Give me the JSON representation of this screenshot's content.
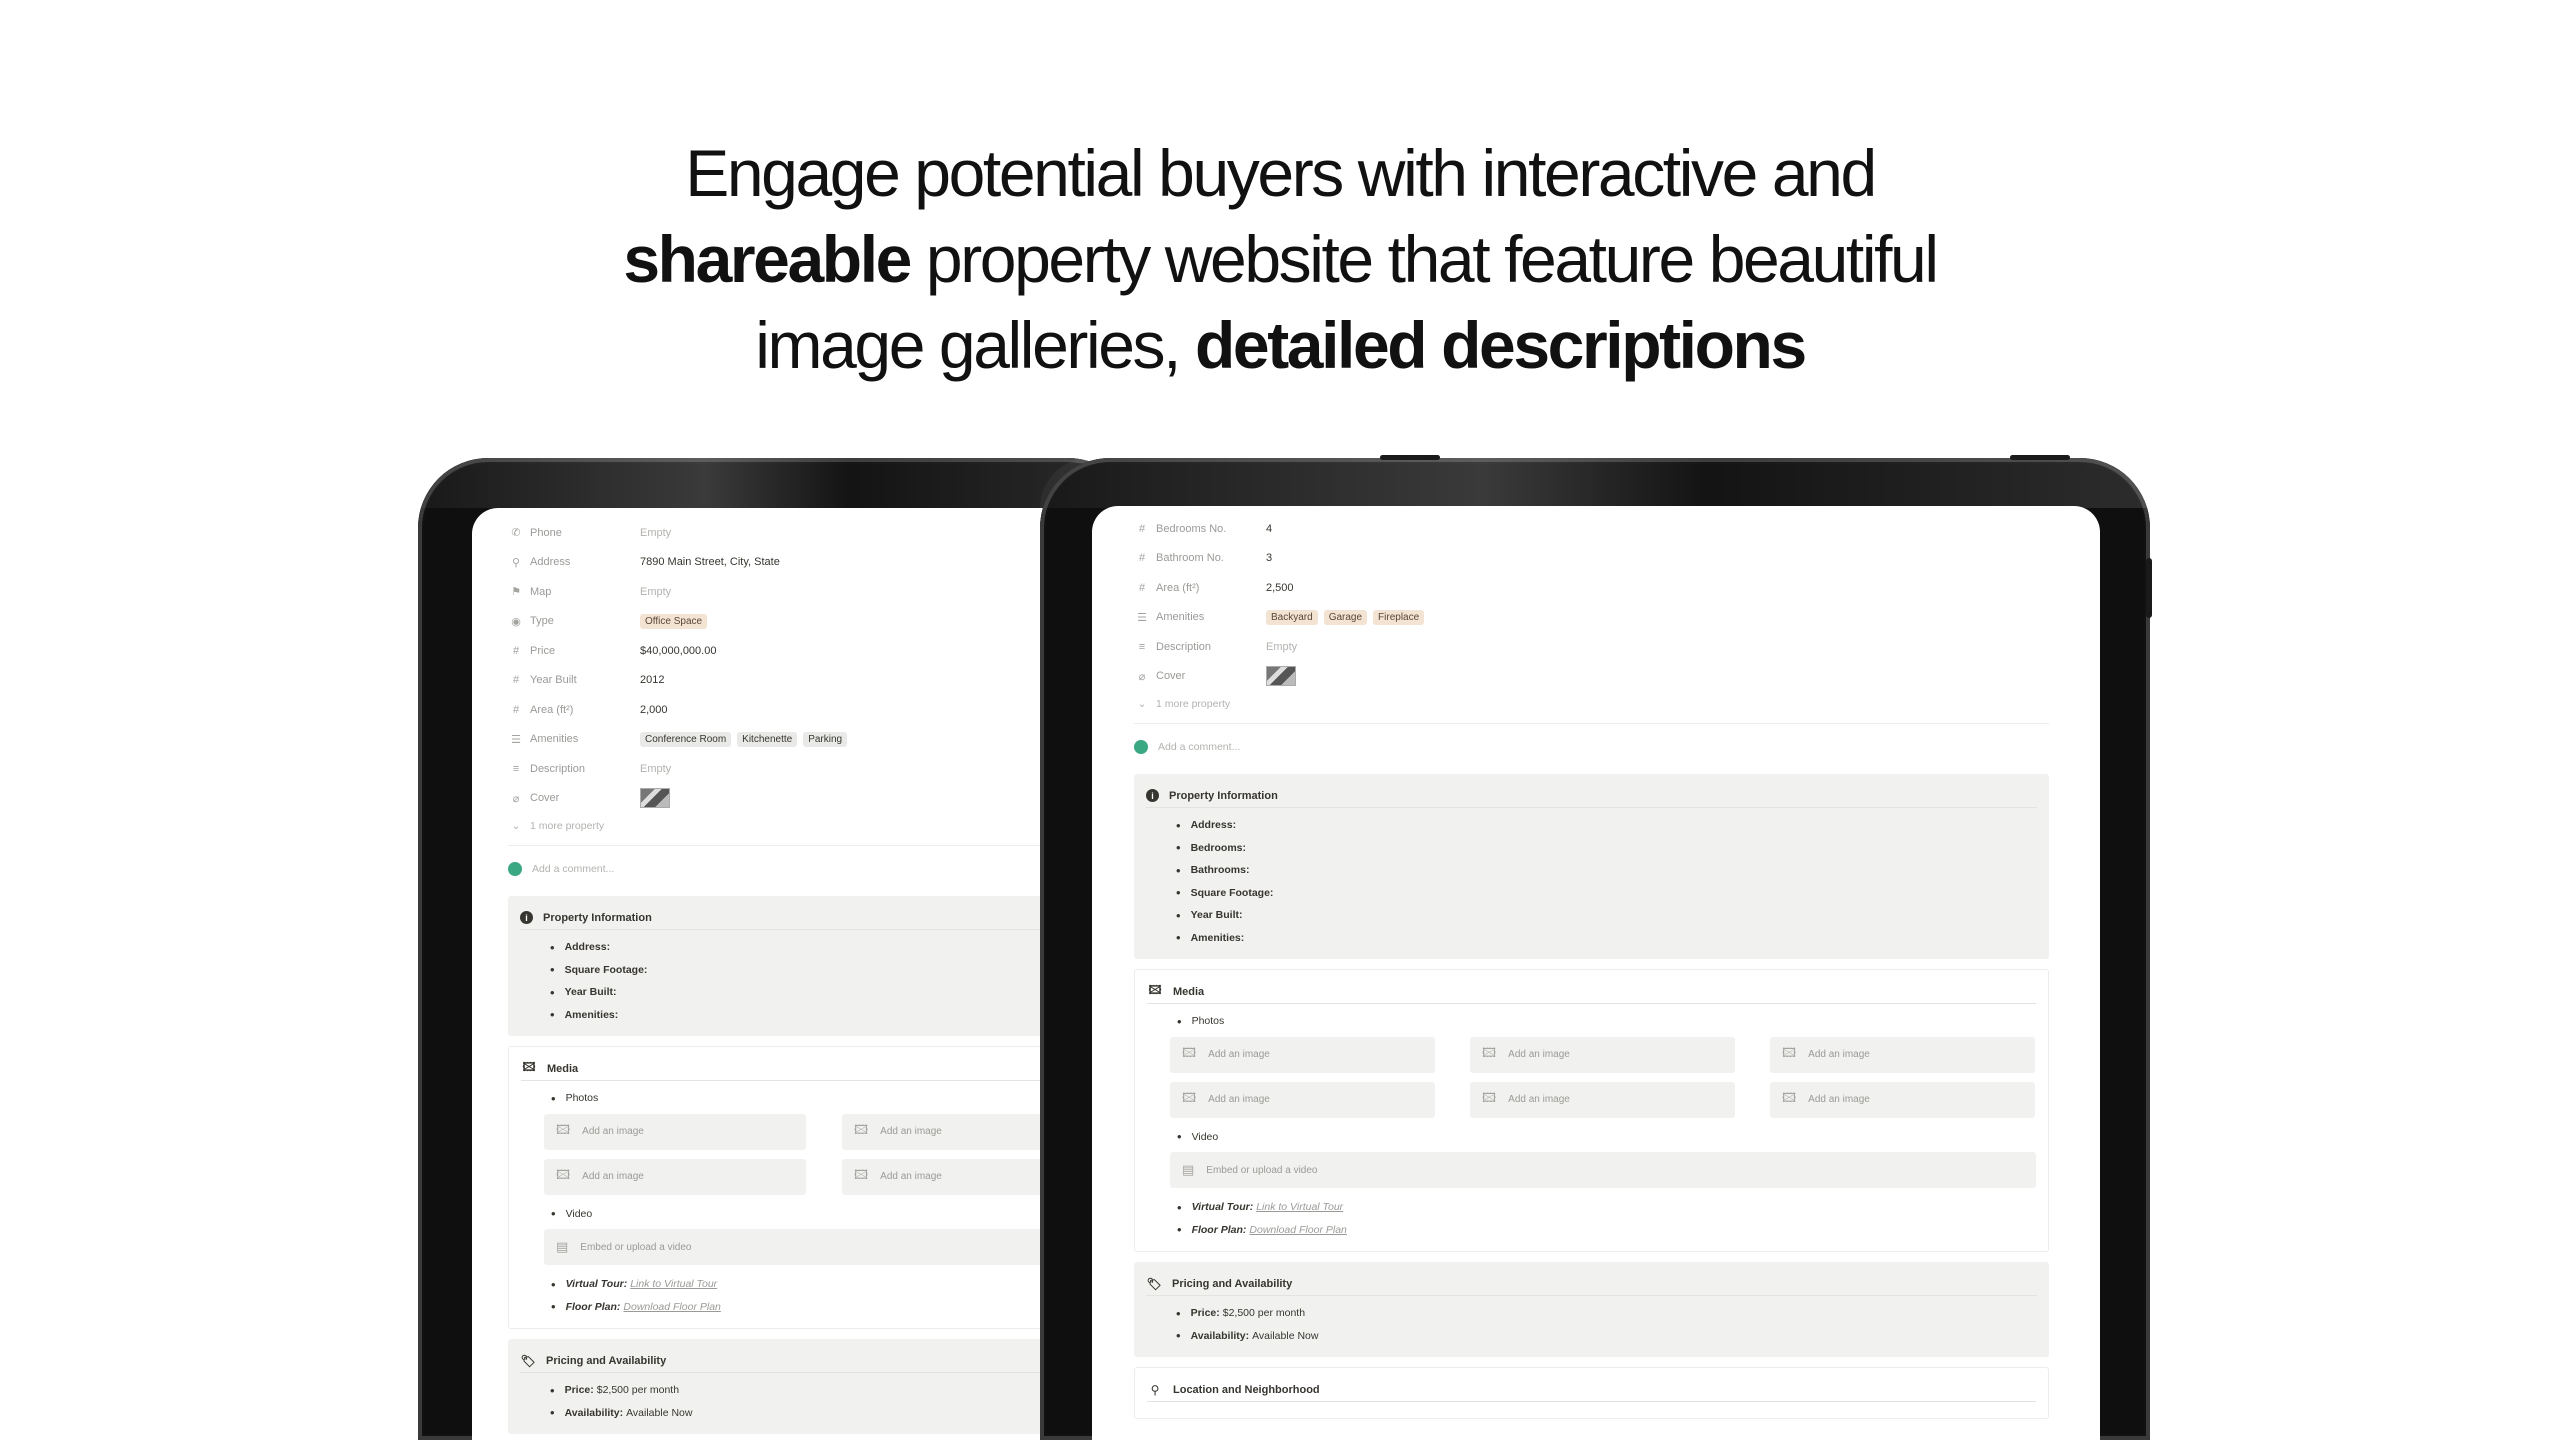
{
  "headline": {
    "line1": "Engage potential buyers with interactive and",
    "line2_bold": "shareable",
    "line2_rest": " property website that feature beautiful",
    "line3_rest": "image galleries, ",
    "line3_bold": "detailed descriptions"
  },
  "back_page": {
    "properties": [
      {
        "icon": "phone-icon",
        "glyph": "✆",
        "key": "Phone",
        "value": "Empty",
        "empty": true
      },
      {
        "icon": "pin-icon",
        "glyph": "⚲",
        "key": "Address",
        "value": "7890 Main Street, City, State",
        "empty": false
      },
      {
        "icon": "map-pin-icon",
        "glyph": "⚑",
        "key": "Map",
        "value": "Empty",
        "empty": true
      },
      {
        "icon": "select-icon",
        "glyph": "◉",
        "key": "Type",
        "tags": [
          "Office Space"
        ],
        "warm": true
      },
      {
        "icon": "hash-icon",
        "glyph": "#",
        "key": "Price",
        "value": "$40,000,000.00",
        "empty": false
      },
      {
        "icon": "hash-icon",
        "glyph": "#",
        "key": "Year Built",
        "value": "2012",
        "empty": false
      },
      {
        "icon": "hash-icon",
        "glyph": "#",
        "key": "Area (ft²)",
        "value": "2,000",
        "empty": false
      },
      {
        "icon": "list-icon",
        "glyph": "☰",
        "key": "Amenities",
        "tags": [
          "Conference Room",
          "Kitchenette",
          "Parking"
        ],
        "warm": false
      },
      {
        "icon": "text-icon",
        "glyph": "≡",
        "key": "Description",
        "value": "Empty",
        "empty": true
      },
      {
        "icon": "paperclip-icon",
        "glyph": "⌀",
        "key": "Cover",
        "cover": true
      }
    ],
    "more_label": "1 more property",
    "comment_placeholder": "Add a comment...",
    "info_title": "Property Information",
    "info_items": [
      "Address:",
      "Square Footage:",
      "Year Built:",
      "Amenities:"
    ],
    "media_title": "Media",
    "photos_label": "Photos",
    "add_image": "Add an image",
    "video_label": "Video",
    "embed_video": "Embed or upload a video",
    "virtual_tour_label": "Virtual Tour:",
    "virtual_tour_link": "Link to Virtual Tour",
    "floor_plan_label": "Floor Plan:",
    "floor_plan_link": "Download Floor Plan",
    "pricing_title": "Pricing and Availability",
    "price_label": "Price:",
    "price_value": "$2,500 per month",
    "availability_label": "Availability:",
    "availability_value": "Available Now"
  },
  "front_page": {
    "properties": [
      {
        "icon": "hash-icon",
        "glyph": "#",
        "key": "Bedrooms No.",
        "value": "4",
        "empty": false
      },
      {
        "icon": "hash-icon",
        "glyph": "#",
        "key": "Bathroom No.",
        "value": "3",
        "empty": false
      },
      {
        "icon": "hash-icon",
        "glyph": "#",
        "key": "Area (ft²)",
        "value": "2,500",
        "empty": false
      },
      {
        "icon": "list-icon",
        "glyph": "☰",
        "key": "Amenities",
        "tags": [
          "Backyard",
          "Garage",
          "Fireplace"
        ],
        "warm": true
      },
      {
        "icon": "text-icon",
        "glyph": "≡",
        "key": "Description",
        "value": "Empty",
        "empty": true
      },
      {
        "icon": "paperclip-icon",
        "glyph": "⌀",
        "key": "Cover",
        "cover": true
      }
    ],
    "more_label": "1 more property",
    "comment_placeholder": "Add a comment...",
    "info_title": "Property Information",
    "info_items": [
      "Address:",
      "Bedrooms:",
      "Bathrooms:",
      "Square Footage:",
      "Year Built:",
      "Amenities:"
    ],
    "media_title": "Media",
    "photos_label": "Photos",
    "add_image": "Add an image",
    "video_label": "Video",
    "embed_video": "Embed or upload a video",
    "virtual_tour_label": "Virtual Tour:",
    "virtual_tour_link": "Link to Virtual Tour",
    "floor_plan_label": "Floor Plan:",
    "floor_plan_link": "Download Floor Plan",
    "pricing_title": "Pricing and Availability",
    "price_label": "Price:",
    "price_value": "$2,500 per month",
    "availability_label": "Availability:",
    "availability_value": "Available Now",
    "location_title": "Location and Neighborhood"
  }
}
